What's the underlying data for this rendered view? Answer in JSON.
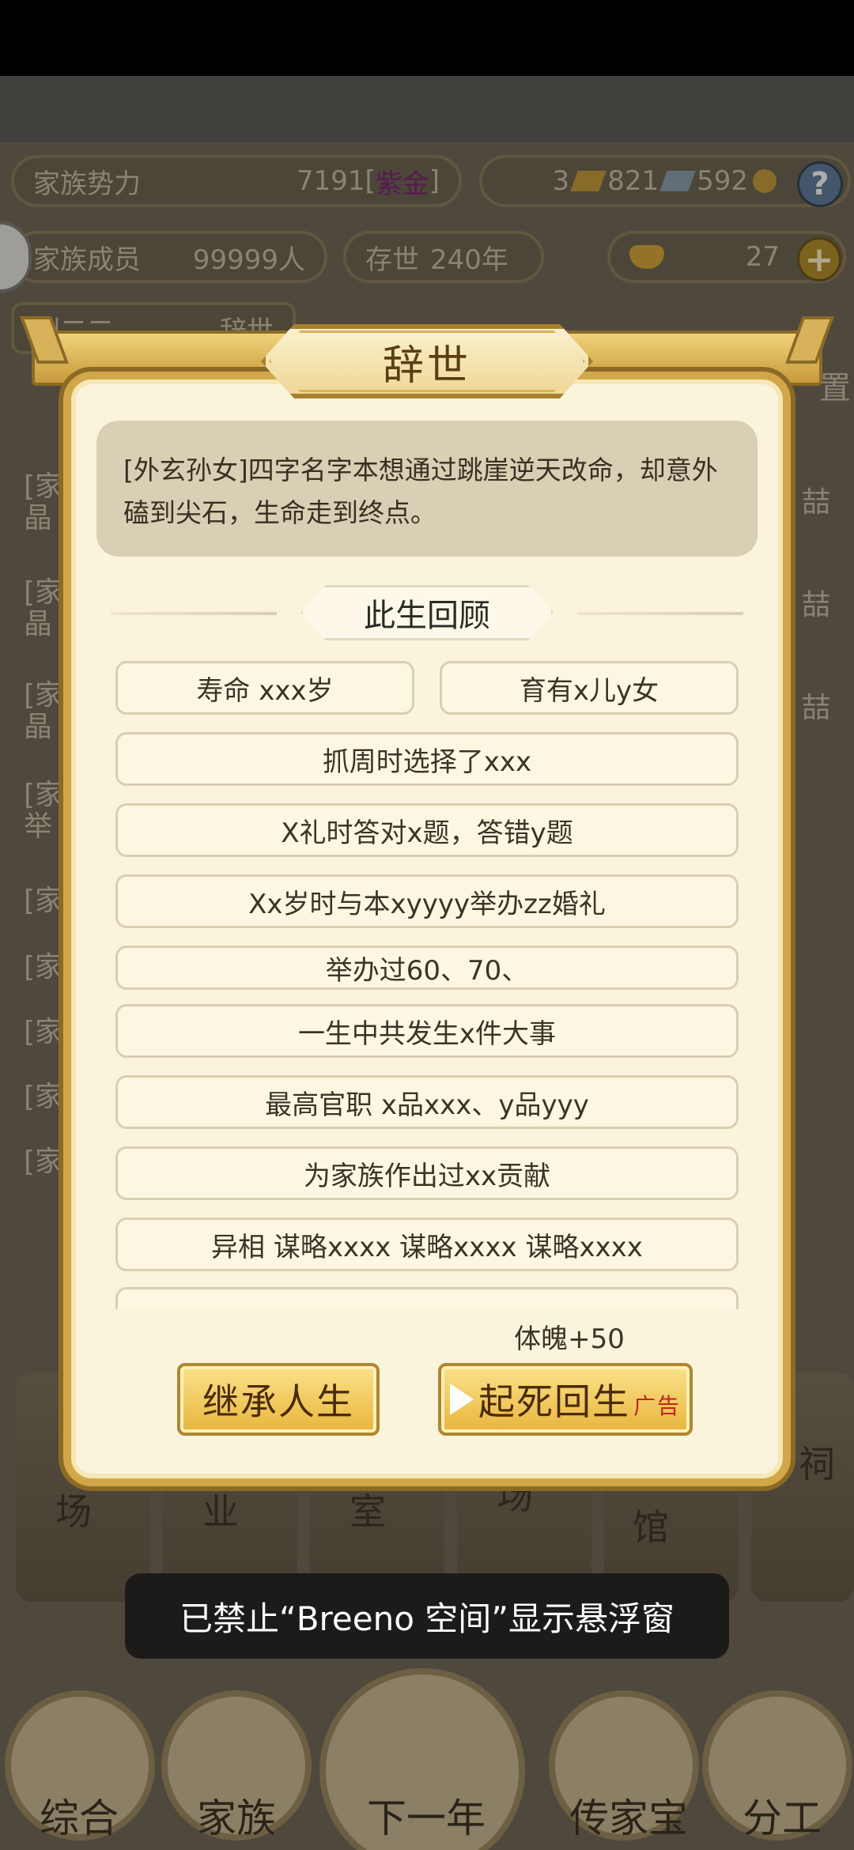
{
  "hud": {
    "family_power_label": "家族势力",
    "family_power_value": "7191",
    "family_power_rank_open": "[",
    "family_power_rank": "紫金",
    "family_power_rank_close": "]",
    "gold_count": "3",
    "silver_count": "821",
    "coin_count": "592",
    "help_icon": "?",
    "members_label": "家族成员",
    "members_value": "99999人",
    "existence_label": "存世",
    "existence_value": "240年",
    "ingot_count": "27",
    "add_icon": "+",
    "person_name": "刘二二",
    "person_status": "辞世",
    "side_partial_right": "置"
  },
  "background_rows": [
    {
      "left": "[家\n晶",
      "right": "喆"
    },
    {
      "left": "[家\n晶",
      "right": "喆"
    },
    {
      "left": "[家\n晶",
      "right": "喆"
    },
    {
      "left": "[家\n举",
      "right": ""
    },
    {
      "left": "[家",
      "right": ""
    },
    {
      "left": "[家",
      "right": ""
    },
    {
      "left": "[家",
      "right": ""
    },
    {
      "left": "[家",
      "right": ""
    },
    {
      "left": "[家",
      "right": ""
    }
  ],
  "dialog": {
    "title": "辞世",
    "description": "[外玄孙女]四字名字本想通过跳崖逆天改命，却意外磕到尖石，生命走到终点。",
    "section_title": "此生回顾",
    "entries": [
      "寿命 xxx岁",
      "育有x儿y女",
      "抓周时选择了xxx",
      "X礼时答对x题，答错y题",
      "Xx岁时与本xyyyy举办zz婚礼",
      "举办过60、70、",
      "一生中共发生x件大事",
      "最高官职 x品xxx、y品yyy",
      "为家族作出过xx贡献",
      "异相  谋略xxxx 谋略xxxx 谋略xxxx"
    ],
    "reward": "体魄+50",
    "inherit_button": "继承人生",
    "revive_button": "起死回生",
    "ad_label": "广告"
  },
  "toast": "已禁止“Breeno 空间”显示悬浮窗",
  "bottom_nav": [
    {
      "label": "综合"
    },
    {
      "label": "家族"
    },
    {
      "label": "下一年"
    },
    {
      "label": "传家宝"
    },
    {
      "label": "分工"
    }
  ],
  "background_buildings": [
    "场",
    "业",
    "室",
    "场",
    "馆",
    "祠"
  ],
  "colors": {
    "gold_border": "#d2a74a",
    "dialog_bg": "#fbf4dc",
    "button_gold": "#e8b53d",
    "ad_red": "#c0271a",
    "rank_purple": "#8a1f8a"
  }
}
